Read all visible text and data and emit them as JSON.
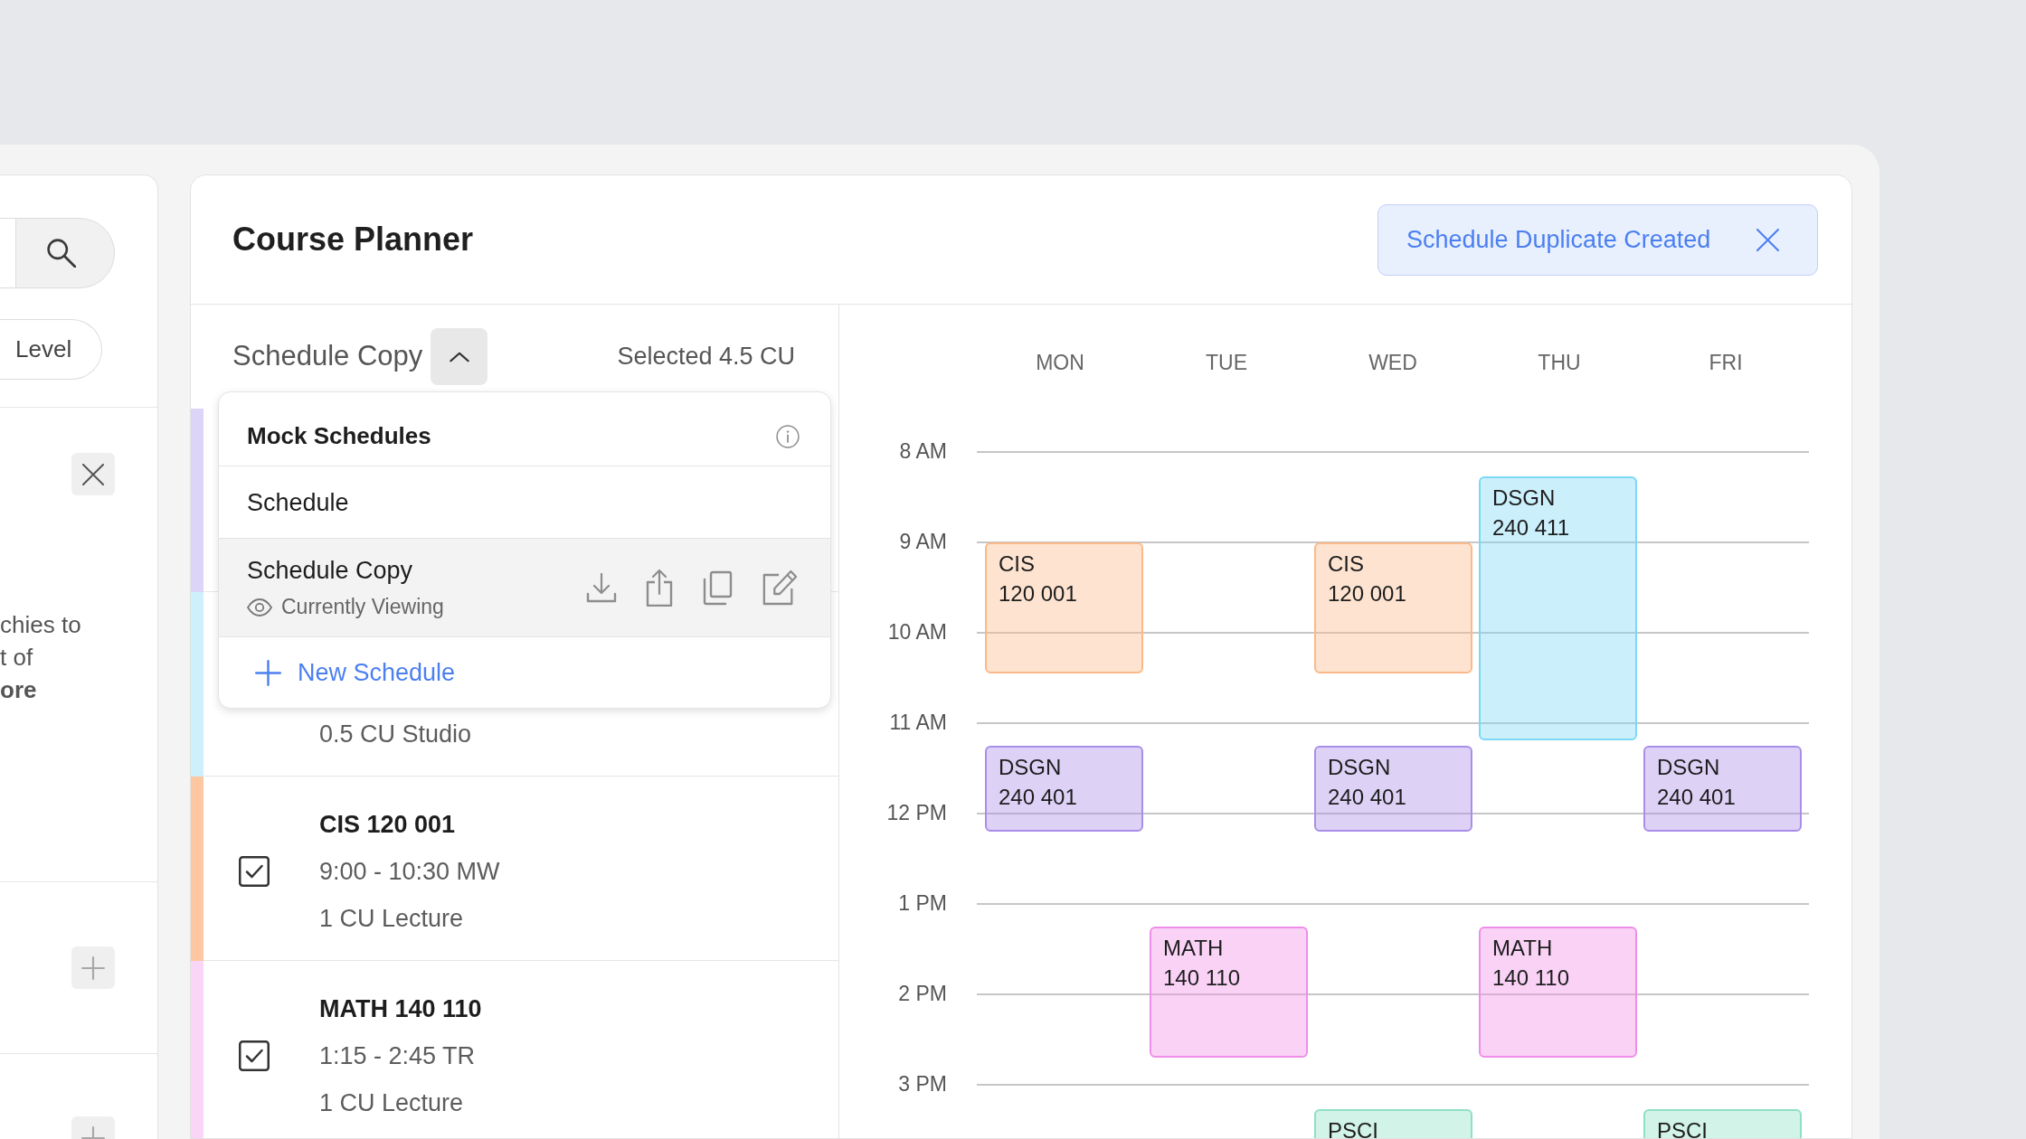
{
  "side_panel": {
    "filter_chip": "Level",
    "notice_lines": [
      "chies to",
      "t of",
      "**ore**"
    ]
  },
  "header": {
    "title": "Course Planner",
    "toast": {
      "message": "Schedule Duplicate Created"
    }
  },
  "schedule_picker": {
    "current": "Schedule Copy",
    "expanded": true,
    "selected_total": "Selected 4.5 CU"
  },
  "schedule_menu": {
    "title": "Mock Schedules",
    "items": [
      {
        "name": "Schedule",
        "selected": false
      },
      {
        "name": "Schedule Copy",
        "selected": true,
        "status": "Currently Viewing"
      }
    ],
    "new_label": "New Schedule"
  },
  "courses": [
    {
      "color": "#ddd5f7"
    },
    {
      "color": "#cdf0fc",
      "type": "0.5 CU Studio"
    },
    {
      "color": "#fdc8a1",
      "checked": true,
      "title": "CIS 120 001",
      "time": "9:00 - 10:30 MW",
      "type": "1 CU Lecture"
    },
    {
      "color": "#f9d5f8",
      "checked": true,
      "title": "MATH 140 110",
      "time": "1:15 - 2:45 TR",
      "type": "1 CU Lecture"
    }
  ],
  "calendar": {
    "hours": [
      "8 AM",
      "9 AM",
      "10 AM",
      "11 AM",
      "12 PM",
      "1 PM",
      "2 PM",
      "3 PM"
    ],
    "days": [
      {
        "label": "MON",
        "events": [
          {
            "subject": "CIS",
            "number": "120 001",
            "color": "#fbb98a"
          },
          {
            "subject": "DSGN",
            "number": "240 401",
            "color": "#a98ee8"
          }
        ]
      },
      {
        "label": "TUE",
        "events": [
          {
            "subject": "MATH",
            "number": "140 110",
            "color": "#ef8ee8"
          }
        ]
      },
      {
        "label": "WED",
        "events": [
          {
            "subject": "CIS",
            "number": "120 001",
            "color": "#fbb98a"
          },
          {
            "subject": "DSGN",
            "number": "240 401",
            "color": "#a98ee8"
          },
          {
            "subject": "PSCI",
            "color": "#8fe0c3"
          }
        ]
      },
      {
        "label": "THU",
        "events": [
          {
            "subject": "DSGN",
            "number": "240 411",
            "color": "#7dd8f5"
          },
          {
            "subject": "MATH",
            "number": "140 110",
            "color": "#ef8ee8"
          }
        ]
      },
      {
        "label": "FRI",
        "events": [
          {
            "subject": "DSGN",
            "number": "240 401",
            "color": "#a98ee8"
          },
          {
            "subject": "PSCI",
            "color": "#8fe0c3"
          }
        ]
      }
    ]
  }
}
